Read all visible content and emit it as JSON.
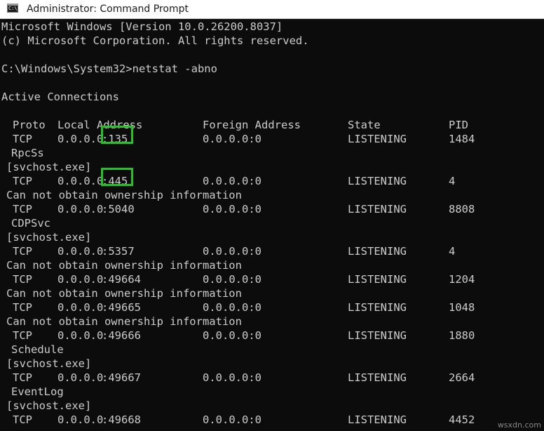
{
  "window": {
    "title": "Administrator: Command Prompt",
    "icon": "console-icon",
    "icon_text": "C:\\."
  },
  "console": {
    "banner": [
      "Microsoft Windows [Version 10.0.26200.8037]",
      "(c) Microsoft Corporation. All rights reserved."
    ],
    "prompt": "C:\\Windows\\System32>",
    "command": "netstat -abno",
    "section_title": "Active Connections",
    "headers": {
      "proto": "Proto",
      "local": "Local Address",
      "foreign": "Foreign Address",
      "state": "State",
      "pid": "PID"
    },
    "connections": [
      {
        "proto": "TCP",
        "local_ip": "0.0.0.0",
        "local_port": ":135",
        "foreign": "0.0.0.0:0",
        "state": "LISTENING",
        "pid": "1484",
        "owner": [
          "RpcSs",
          "[svchost.exe]"
        ],
        "highlight": true
      },
      {
        "proto": "TCP",
        "local_ip": "0.0.0.0",
        "local_port": ":445",
        "foreign": "0.0.0.0:0",
        "state": "LISTENING",
        "pid": "4",
        "owner": [
          "Can not obtain ownership information"
        ],
        "highlight": true
      },
      {
        "proto": "TCP",
        "local_ip": "0.0.0.0",
        "local_port": ":5040",
        "foreign": "0.0.0.0:0",
        "state": "LISTENING",
        "pid": "8808",
        "owner": [
          "CDPSvc",
          "[svchost.exe]"
        ],
        "highlight": false
      },
      {
        "proto": "TCP",
        "local_ip": "0.0.0.0",
        "local_port": ":5357",
        "foreign": "0.0.0.0:0",
        "state": "LISTENING",
        "pid": "4",
        "owner": [
          "Can not obtain ownership information"
        ],
        "highlight": false
      },
      {
        "proto": "TCP",
        "local_ip": "0.0.0.0",
        "local_port": ":49664",
        "foreign": "0.0.0.0:0",
        "state": "LISTENING",
        "pid": "1204",
        "owner": [
          "Can not obtain ownership information"
        ],
        "highlight": false
      },
      {
        "proto": "TCP",
        "local_ip": "0.0.0.0",
        "local_port": ":49665",
        "foreign": "0.0.0.0:0",
        "state": "LISTENING",
        "pid": "1048",
        "owner": [
          "Can not obtain ownership information"
        ],
        "highlight": false
      },
      {
        "proto": "TCP",
        "local_ip": "0.0.0.0",
        "local_port": ":49666",
        "foreign": "0.0.0.0:0",
        "state": "LISTENING",
        "pid": "1880",
        "owner": [
          "Schedule",
          "[svchost.exe]"
        ],
        "highlight": false
      },
      {
        "proto": "TCP",
        "local_ip": "0.0.0.0",
        "local_port": ":49667",
        "foreign": "0.0.0.0:0",
        "state": "LISTENING",
        "pid": "2664",
        "owner": [
          "EventLog",
          "[svchost.exe]"
        ],
        "highlight": false
      },
      {
        "proto": "TCP",
        "local_ip": "0.0.0.0",
        "local_port": ":49668",
        "foreign": "0.0.0.0:0",
        "state": "LISTENING",
        "pid": "4452",
        "owner": [],
        "highlight": false
      }
    ]
  },
  "watermark": "wsxdn.com",
  "colors": {
    "background": "#0c0c0c",
    "text": "#cccccc",
    "highlight": "#24c324",
    "titlebar": "#ffffff"
  }
}
